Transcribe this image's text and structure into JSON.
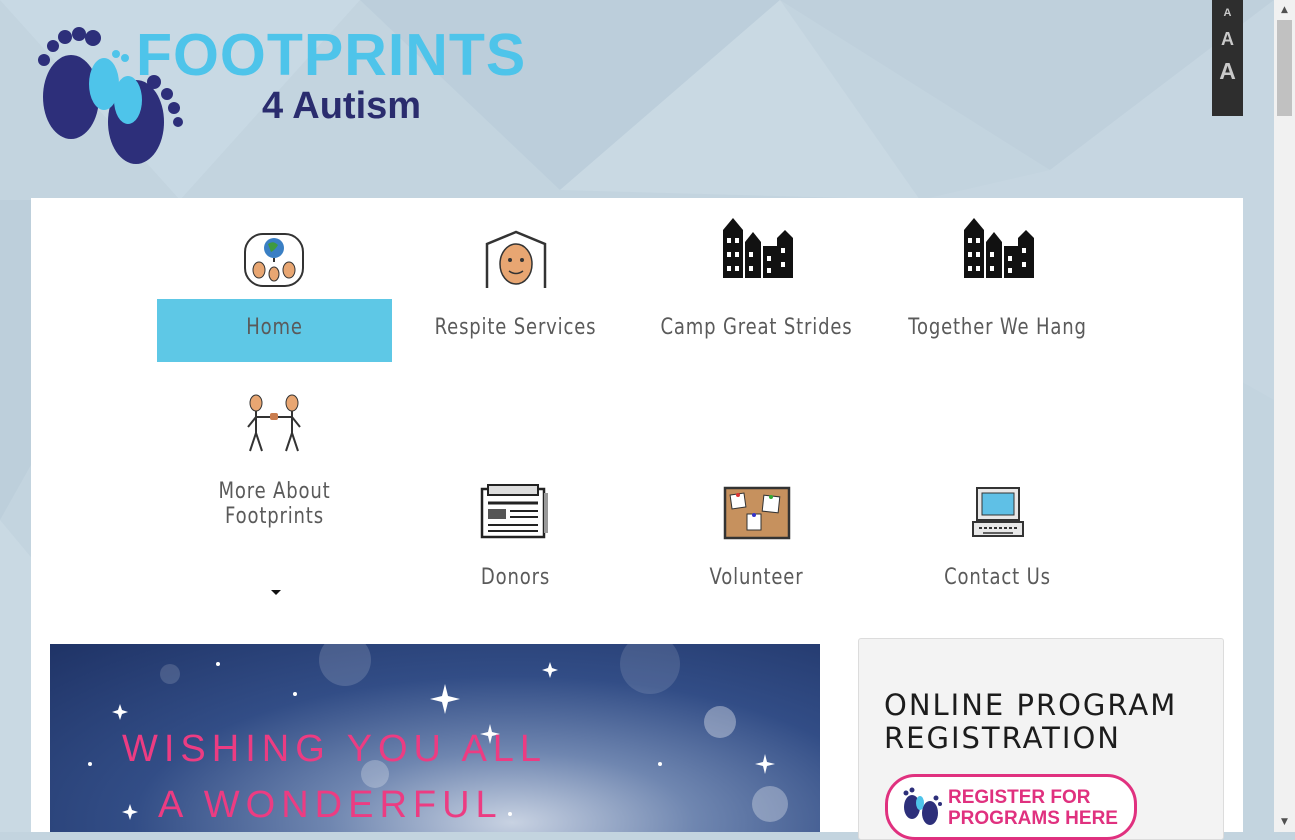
{
  "logo": {
    "line1": "FOOTPRINTS",
    "line2": "4 Autism"
  },
  "font_sizer": {
    "small": "A",
    "medium": "A",
    "large": "A"
  },
  "nav": [
    {
      "label": "Home",
      "icon": "family-globe-icon",
      "active": true
    },
    {
      "label": "Respite Services",
      "icon": "house-person-icon"
    },
    {
      "label": "Camp Great Strides",
      "icon": "buildings-icon"
    },
    {
      "label": "Together We Hang",
      "icon": "buildings-icon"
    },
    {
      "label": "More About Footprints",
      "icon": "handshake-icon",
      "has_dropdown": true
    },
    {
      "label": "Donors",
      "icon": "newspaper-icon"
    },
    {
      "label": "Volunteer",
      "icon": "bulletin-board-icon"
    },
    {
      "label": "Contact Us",
      "icon": "laptop-icon"
    }
  ],
  "banner": {
    "line1": "WISHING YOU ALL",
    "line2": "A WONDERFUL"
  },
  "sidebar": {
    "title": "ONLINE PROGRAM REGISTRATION",
    "button_label": "REGISTER FOR PROGRAMS HERE"
  },
  "colors": {
    "brand_blue": "#4ec4ea",
    "brand_navy": "#2a2c6e",
    "nav_active_bg": "#5ec8e6",
    "accent_pink": "#e0317f"
  }
}
